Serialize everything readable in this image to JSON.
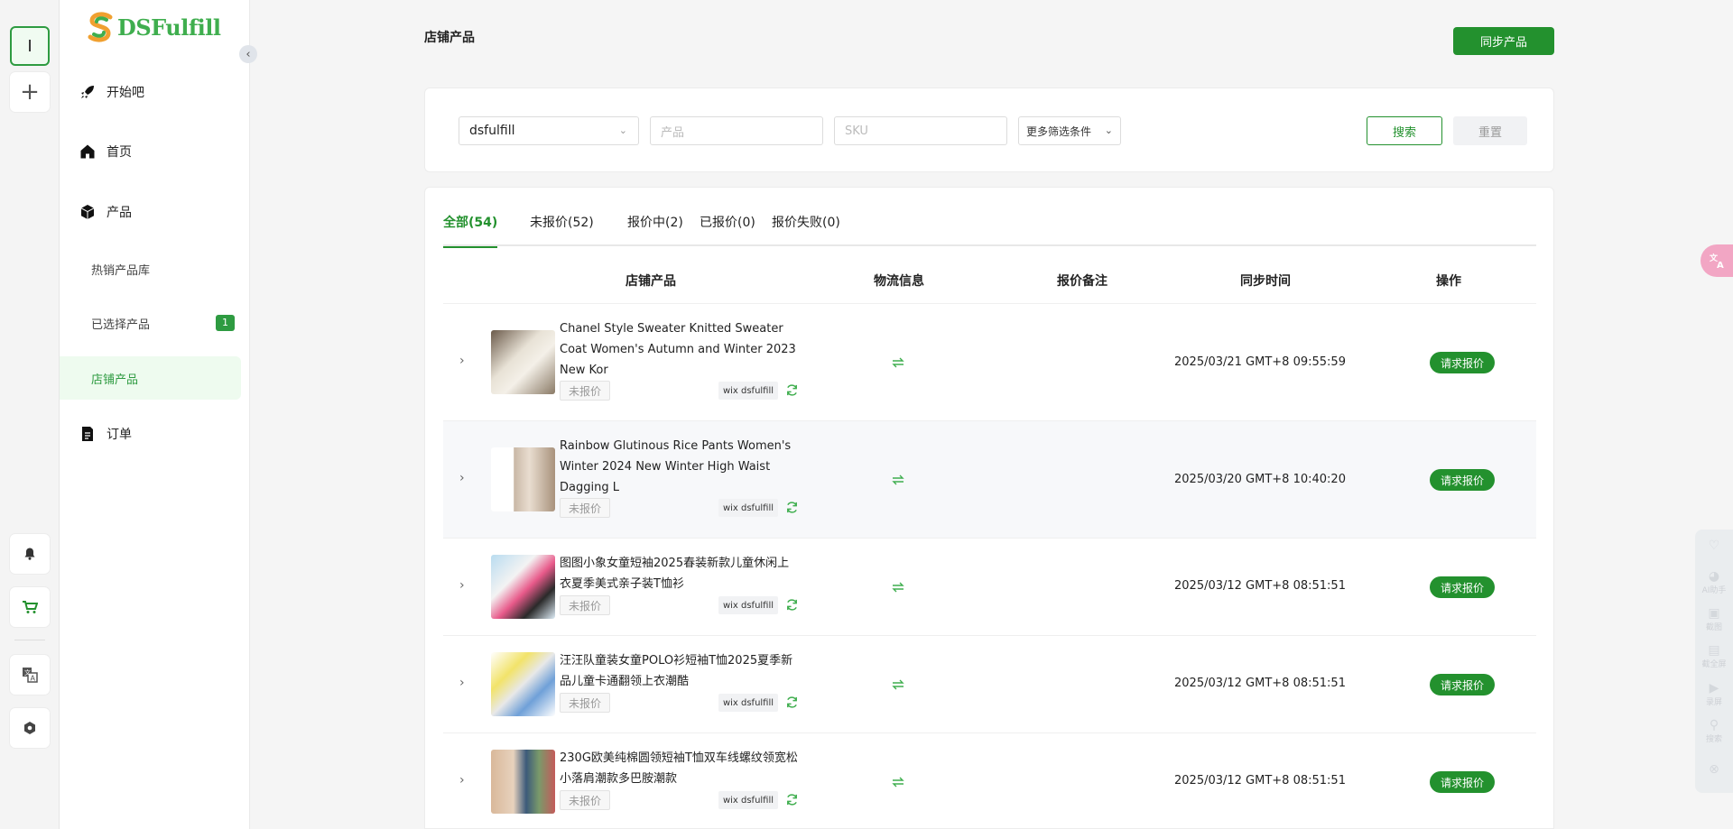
{
  "rail": {
    "workspace_letter": "I",
    "add_symbol": "+"
  },
  "brand": {
    "name": "DSFulfill",
    "accent": "#3fae4e"
  },
  "sidebar": {
    "collapse_symbol": "‹",
    "nav": [
      {
        "label": "开始吧",
        "icon": "rocket-icon"
      },
      {
        "label": "首页",
        "icon": "home-icon"
      },
      {
        "label": "产品",
        "icon": "box-icon"
      },
      {
        "label": "订单",
        "icon": "document-icon"
      }
    ],
    "sub": [
      {
        "label": "热销产品库"
      },
      {
        "label": "已选择产品",
        "badge": "1"
      },
      {
        "label": "店铺产品",
        "active": true
      }
    ]
  },
  "page": {
    "title": "店铺产品",
    "sync_button": "同步产品"
  },
  "filters": {
    "store_value": "dsfulfill",
    "product_placeholder": "产品",
    "sku_placeholder": "SKU",
    "more_label": "更多筛选条件",
    "search_label": "搜索",
    "reset_label": "重置"
  },
  "tabs": [
    {
      "label": "全部(54)",
      "active": true
    },
    {
      "label": "未报价(52)"
    },
    {
      "label": "报价中(2)"
    },
    {
      "label": "已报价(0)"
    },
    {
      "label": "报价失败(0)"
    }
  ],
  "table": {
    "headers": [
      "店铺产品",
      "物流信息",
      "报价备注",
      "同步时间",
      "操作"
    ],
    "rows": [
      {
        "title": "Chanel Style Sweater Knitted Sweater Coat Women's Autumn and Winter 2023 New Kor",
        "status": "未报价",
        "store": "wix dsfulfill",
        "sync_time": "2025/03/21 GMT+8 09:55:59",
        "action": "请求报价"
      },
      {
        "title": "Rainbow Glutinous Rice Pants Women's Winter 2024 New Winter High Waist Dagging L",
        "status": "未报价",
        "store": "wix dsfulfill",
        "sync_time": "2025/03/20 GMT+8 10:40:20",
        "action": "请求报价"
      },
      {
        "title": "图图小象女童短袖2025春装新款儿童休闲上衣夏季美式亲子装T恤衫",
        "status": "未报价",
        "store": "wix dsfulfill",
        "sync_time": "2025/03/12 GMT+8 08:51:51",
        "action": "请求报价"
      },
      {
        "title": "汪汪队童装女童POLO衫短袖T恤2025夏季新品儿童卡通翻领上衣潮酷",
        "status": "未报价",
        "store": "wix dsfulfill",
        "sync_time": "2025/03/12 GMT+8 08:51:51",
        "action": "请求报价"
      },
      {
        "title": "230G欧美纯棉圆领短袖T恤双车线螺纹领宽松小落肩潮款多巴胺潮款",
        "status": "未报价",
        "store": "wix dsfulfill",
        "sync_time": "2025/03/12 GMT+8 08:51:51",
        "action": "请求报价"
      }
    ]
  },
  "assistant_panel": {
    "items": [
      "AI助手",
      "截图",
      "截全屏",
      "录屏",
      "搜索"
    ]
  }
}
